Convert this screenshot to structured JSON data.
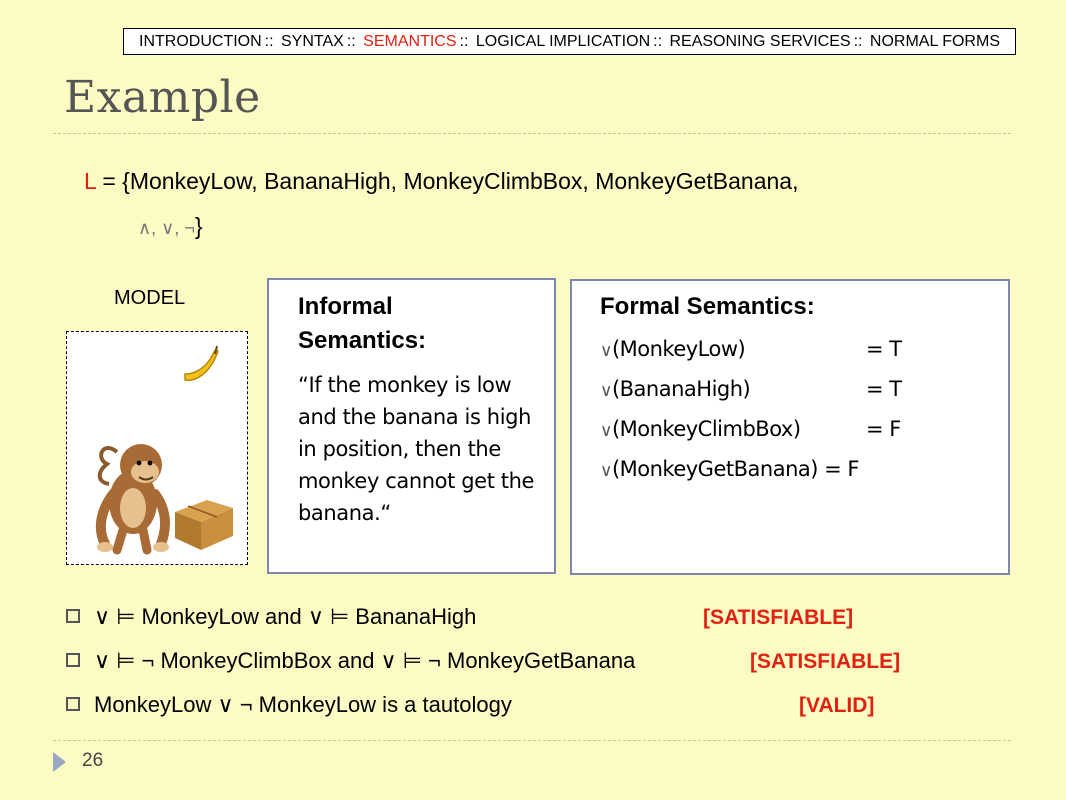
{
  "nav": {
    "items": [
      "INTRODUCTION",
      "SYNTAX",
      "SEMANTICS",
      "LOGICAL IMPLICATION",
      "REASONING SERVICES",
      "NORMAL FORMS"
    ],
    "separator": "::",
    "active": "SEMANTICS"
  },
  "title": "Example",
  "language": {
    "symbol": "L",
    "line1": " = {MonkeyLow, BananaHigh, MonkeyClimbBox, MonkeyGetBanana,",
    "connectives": "∧, ∨, ¬",
    "close": "}"
  },
  "model": {
    "label": "MODEL",
    "icons": [
      "banana-icon",
      "monkey-icon",
      "box-icon"
    ]
  },
  "informal": {
    "heading": "Informal Semantics:",
    "text": "“If the monkey is low and the banana is high in position, then the monkey cannot get the banana.“"
  },
  "formal": {
    "heading": "Formal Semantics:",
    "rows": [
      {
        "v": "∨",
        "arg": "(MonkeyLow)",
        "val": "= T"
      },
      {
        "v": "∨",
        "arg": "(BananaHigh)",
        "val": "= T"
      },
      {
        "v": "∨",
        "arg": "(MonkeyClimbBox)",
        "val": "= F"
      },
      {
        "v": "∨",
        "arg": "(MonkeyGetBanana) = F",
        "val": ""
      }
    ]
  },
  "bullets": [
    {
      "text": "∨ ⊨ MonkeyLow and ∨ ⊨ BananaHigh",
      "tag": "[SATISFIABLE]"
    },
    {
      "text": "∨ ⊨ ¬ MonkeyClimbBox and ∨ ⊨ ¬ MonkeyGetBanana",
      "tag": "[SATISFIABLE]"
    },
    {
      "text": "MonkeyLow ∨ ¬ MonkeyLow is a tautology",
      "tag": "[VALID]"
    }
  ],
  "page_number": "26",
  "colors": {
    "accent": "#e02010",
    "background": "#fdfbc4",
    "box_border": "#7d86ae"
  }
}
